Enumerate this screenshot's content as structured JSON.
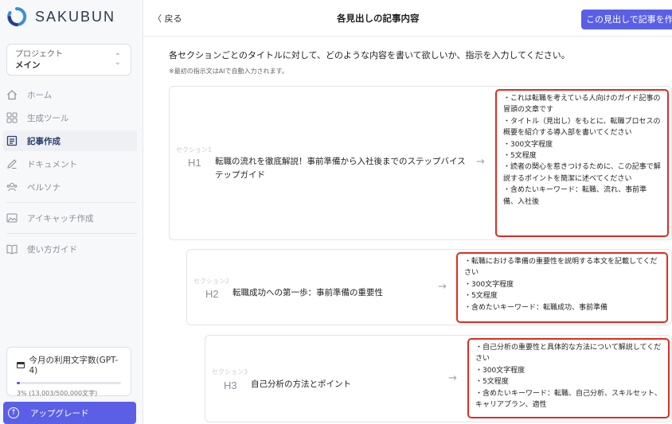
{
  "app": {
    "name": "SAKUBUN"
  },
  "project": {
    "label": "プロジェクト",
    "value": "メイン"
  },
  "nav": {
    "items": [
      {
        "label": "ホーム",
        "icon": "home-icon"
      },
      {
        "label": "生成ツール",
        "icon": "grid-icon"
      },
      {
        "label": "記事作成",
        "icon": "article-icon",
        "active": true
      },
      {
        "label": "ドキュメント",
        "icon": "edit-icon"
      },
      {
        "label": "ペルソナ",
        "icon": "people-icon"
      },
      {
        "label": "アイキャッチ作成",
        "icon": "image-icon"
      },
      {
        "label": "使い方ガイド",
        "icon": "book-icon"
      }
    ]
  },
  "usage": {
    "title": "今月の利用文字数(GPT-4)",
    "progress_percent": 3,
    "detail": "3% (13,003/500,000文字)"
  },
  "upgrade": {
    "label": "アップグレード"
  },
  "header": {
    "back_label": "〈 戻る",
    "title": "各見出しの記事内容",
    "action_label": "この見出しで記事を作成"
  },
  "main": {
    "instruction": "各セクションごとのタイトルに対して、どのような内容を書いて欲しいか、指示を入力してください。",
    "note": "※最初の指示文はAIで自動入力されます。",
    "sections": [
      {
        "section_label": "セクション1",
        "heading_level": "H1",
        "title": "転職の流れを徹底解説！事前準備から入社後までのステップバイステップガイド",
        "prompt": "・これは転職を考えている人向けのガイド記事の冒頭の文章です\n・タイトル（見出し）をもとに、転職プロセスの概要を紹介する導入部を書いてください\n・300文字程度\n・5文程度\n・読者の関心を惹きつけるために、この記事で解説するポイントを簡潔に述べてください\n・含めたいキーワード：転職、流れ、事前準備、入社後"
      },
      {
        "section_label": "セクション2",
        "heading_level": "H2",
        "title": "転職成功への第一歩：事前準備の重要性",
        "prompt": "・転職における準備の重要性を説明する本文を記載してください\n・300文字程度\n・5文程度\n・含めたいキーワード：転職成功、事前準備"
      },
      {
        "section_label": "セクション3",
        "heading_level": "H3",
        "title": "自己分析の方法とポイント",
        "prompt": "・自己分析の重要性と具体的な方法について解説してください\n・300文字程度\n・5文程度\n・含めたいキーワード：転職、自己分析、スキルセット、キャリアプラン、適性"
      }
    ]
  },
  "colors": {
    "accent": "#5a5fe6",
    "highlight_border": "#e02b1f",
    "sidebar_bg": "#f7f8fa"
  }
}
